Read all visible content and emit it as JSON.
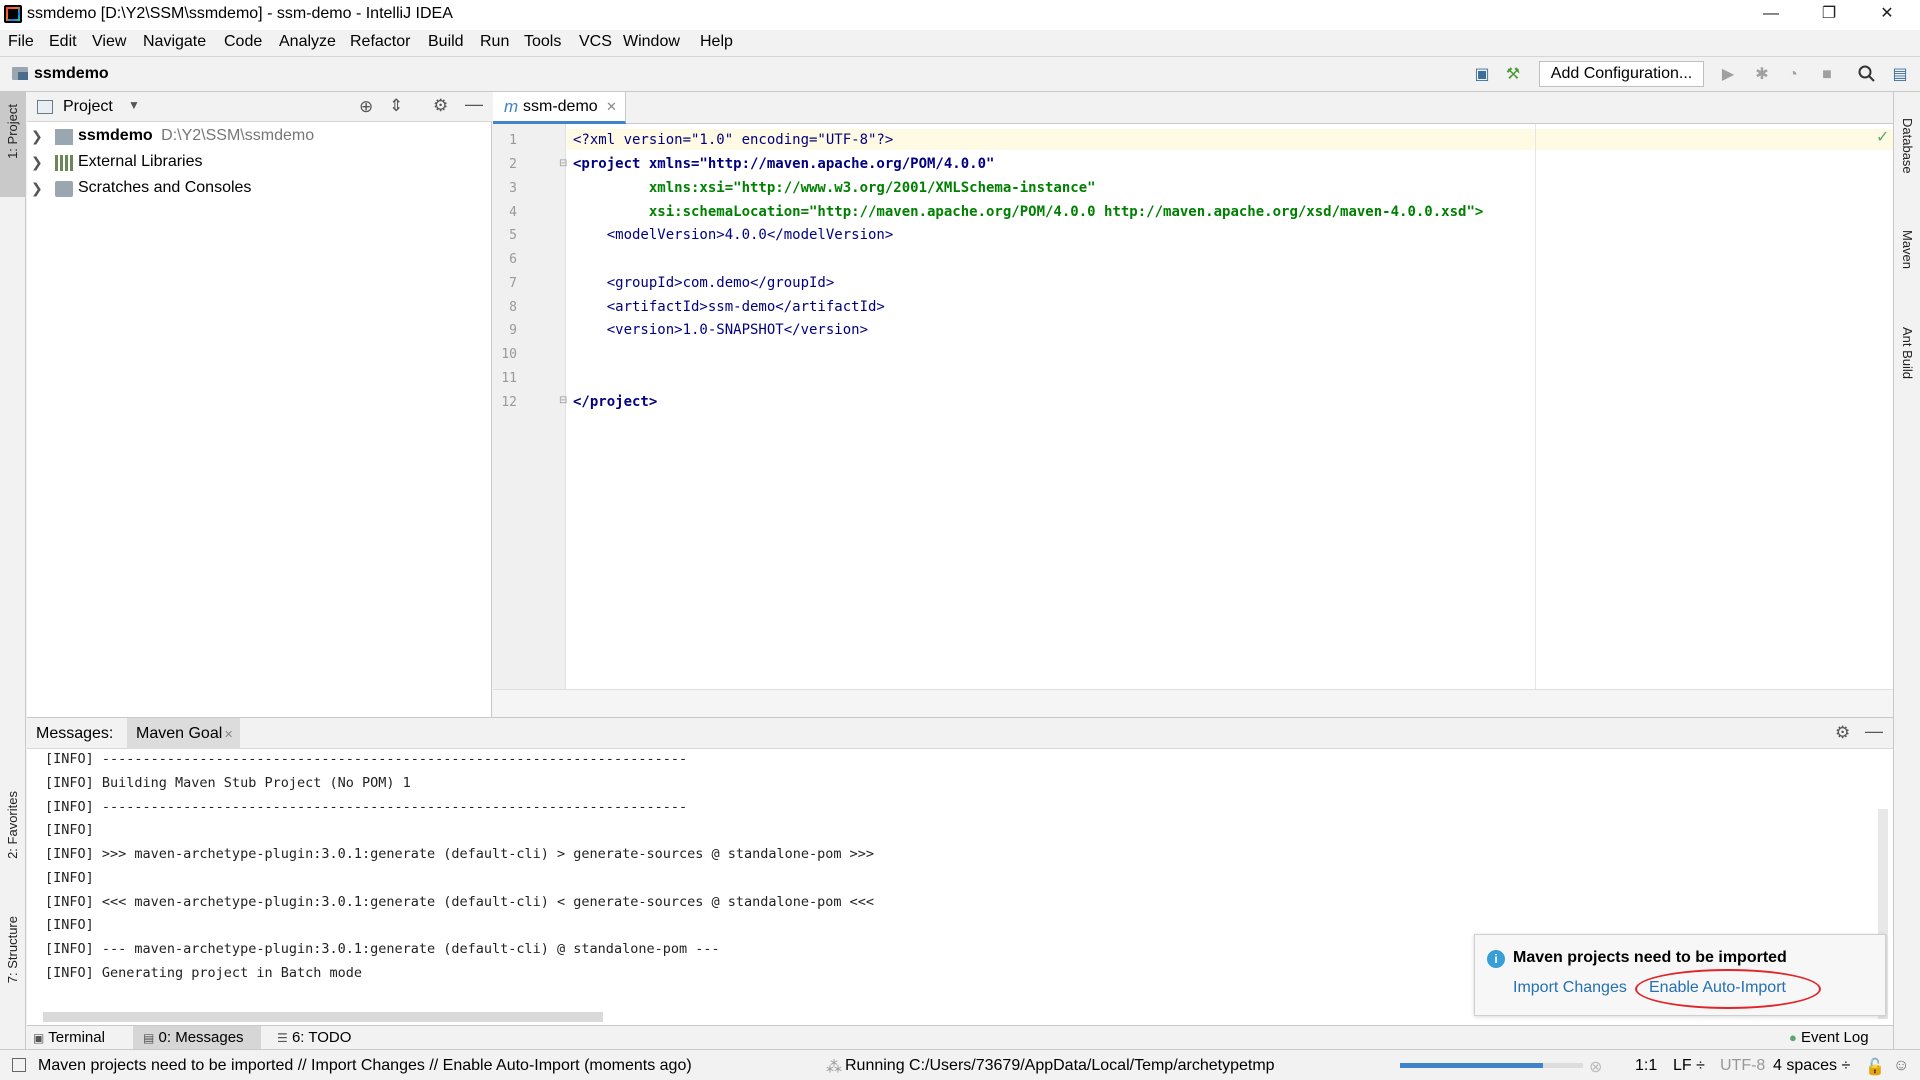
{
  "window": {
    "title": "ssmdemo [D:\\Y2\\SSM\\ssmdemo] - ssm-demo - IntelliJ IDEA",
    "minimize": "—",
    "restore": "❐",
    "close": "✕"
  },
  "menu": [
    "File",
    "Edit",
    "View",
    "Navigate",
    "Code",
    "Analyze",
    "Refactor",
    "Build",
    "Run",
    "Tools",
    "VCS",
    "Window",
    "Help"
  ],
  "navbar": {
    "project_name": "ssmdemo",
    "add_configuration": "Add Configuration..."
  },
  "left_strip": {
    "project_tab": "1: Project",
    "favorites_tab": "2: Favorites",
    "structure_tab": "7: Structure"
  },
  "right_strip": {
    "database_tab": "Database",
    "maven_tab": "Maven",
    "ant_tab": "Ant Build"
  },
  "project_panel": {
    "title": "Project",
    "tree": [
      {
        "label": "ssmdemo",
        "path": "D:\\Y2\\SSM\\ssmdemo"
      },
      {
        "label": "External Libraries",
        "path": ""
      },
      {
        "label": "Scratches and Consoles",
        "path": ""
      }
    ]
  },
  "editor": {
    "tab_label": "ssm-demo",
    "tab_icon_letter": "m",
    "lines": [
      {
        "n": "1",
        "text": "<?xml version=\"1.0\" encoding=\"UTF-8\"?>"
      },
      {
        "n": "2",
        "text": "<project xmlns=\"http://maven.apache.org/POM/4.0.0\""
      },
      {
        "n": "3",
        "text": "         xmlns:xsi=\"http://www.w3.org/2001/XMLSchema-instance\""
      },
      {
        "n": "4",
        "text": "         xsi:schemaLocation=\"http://maven.apache.org/POM/4.0.0 http://maven.apache.org/xsd/maven-4.0.0.xsd\">"
      },
      {
        "n": "5",
        "text": "    <modelVersion>4.0.0</modelVersion>"
      },
      {
        "n": "6",
        "text": ""
      },
      {
        "n": "7",
        "text": "    <groupId>com.demo</groupId>"
      },
      {
        "n": "8",
        "text": "    <artifactId>ssm-demo</artifactId>"
      },
      {
        "n": "9",
        "text": "    <version>1.0-SNAPSHOT</version>"
      },
      {
        "n": "10",
        "text": ""
      },
      {
        "n": "11",
        "text": ""
      },
      {
        "n": "12",
        "text": "</project>"
      }
    ]
  },
  "messages": {
    "label": "Messages:",
    "tab": "Maven Goal",
    "log": [
      "[INFO] ------------------------------------------------------------------------",
      "[INFO] Building Maven Stub Project (No POM) 1",
      "[INFO] ------------------------------------------------------------------------",
      "[INFO]",
      "[INFO] >>> maven-archetype-plugin:3.0.1:generate (default-cli) > generate-sources @ standalone-pom >>>",
      "[INFO]",
      "[INFO] <<< maven-archetype-plugin:3.0.1:generate (default-cli) < generate-sources @ standalone-pom <<<",
      "[INFO]",
      "[INFO] --- maven-archetype-plugin:3.0.1:generate (default-cli) @ standalone-pom ---",
      "[INFO] Generating project in Batch mode"
    ]
  },
  "notification": {
    "title": "Maven projects need to be imported",
    "import_changes": "Import Changes",
    "enable_auto_import": "Enable Auto-Import",
    "icon": "i"
  },
  "bottom_tabs": {
    "terminal": "Terminal",
    "messages": "0: Messages",
    "todo": "6: TODO",
    "event_log": "Event Log"
  },
  "statusbar": {
    "message": "Maven projects need to be imported // Import Changes // Enable Auto-Import (moments ago)",
    "running": "Running C:/Users/73679/AppData/Local/Temp/archetypetmp",
    "progress": 0.78,
    "position": "1:1",
    "line_sep": "LF ÷",
    "encoding": "UTF-8",
    "indent": "4 spaces ÷"
  },
  "colors": {
    "accent": "#4083c9",
    "link": "#2470b3",
    "highlight_circle": "#e0262a"
  }
}
